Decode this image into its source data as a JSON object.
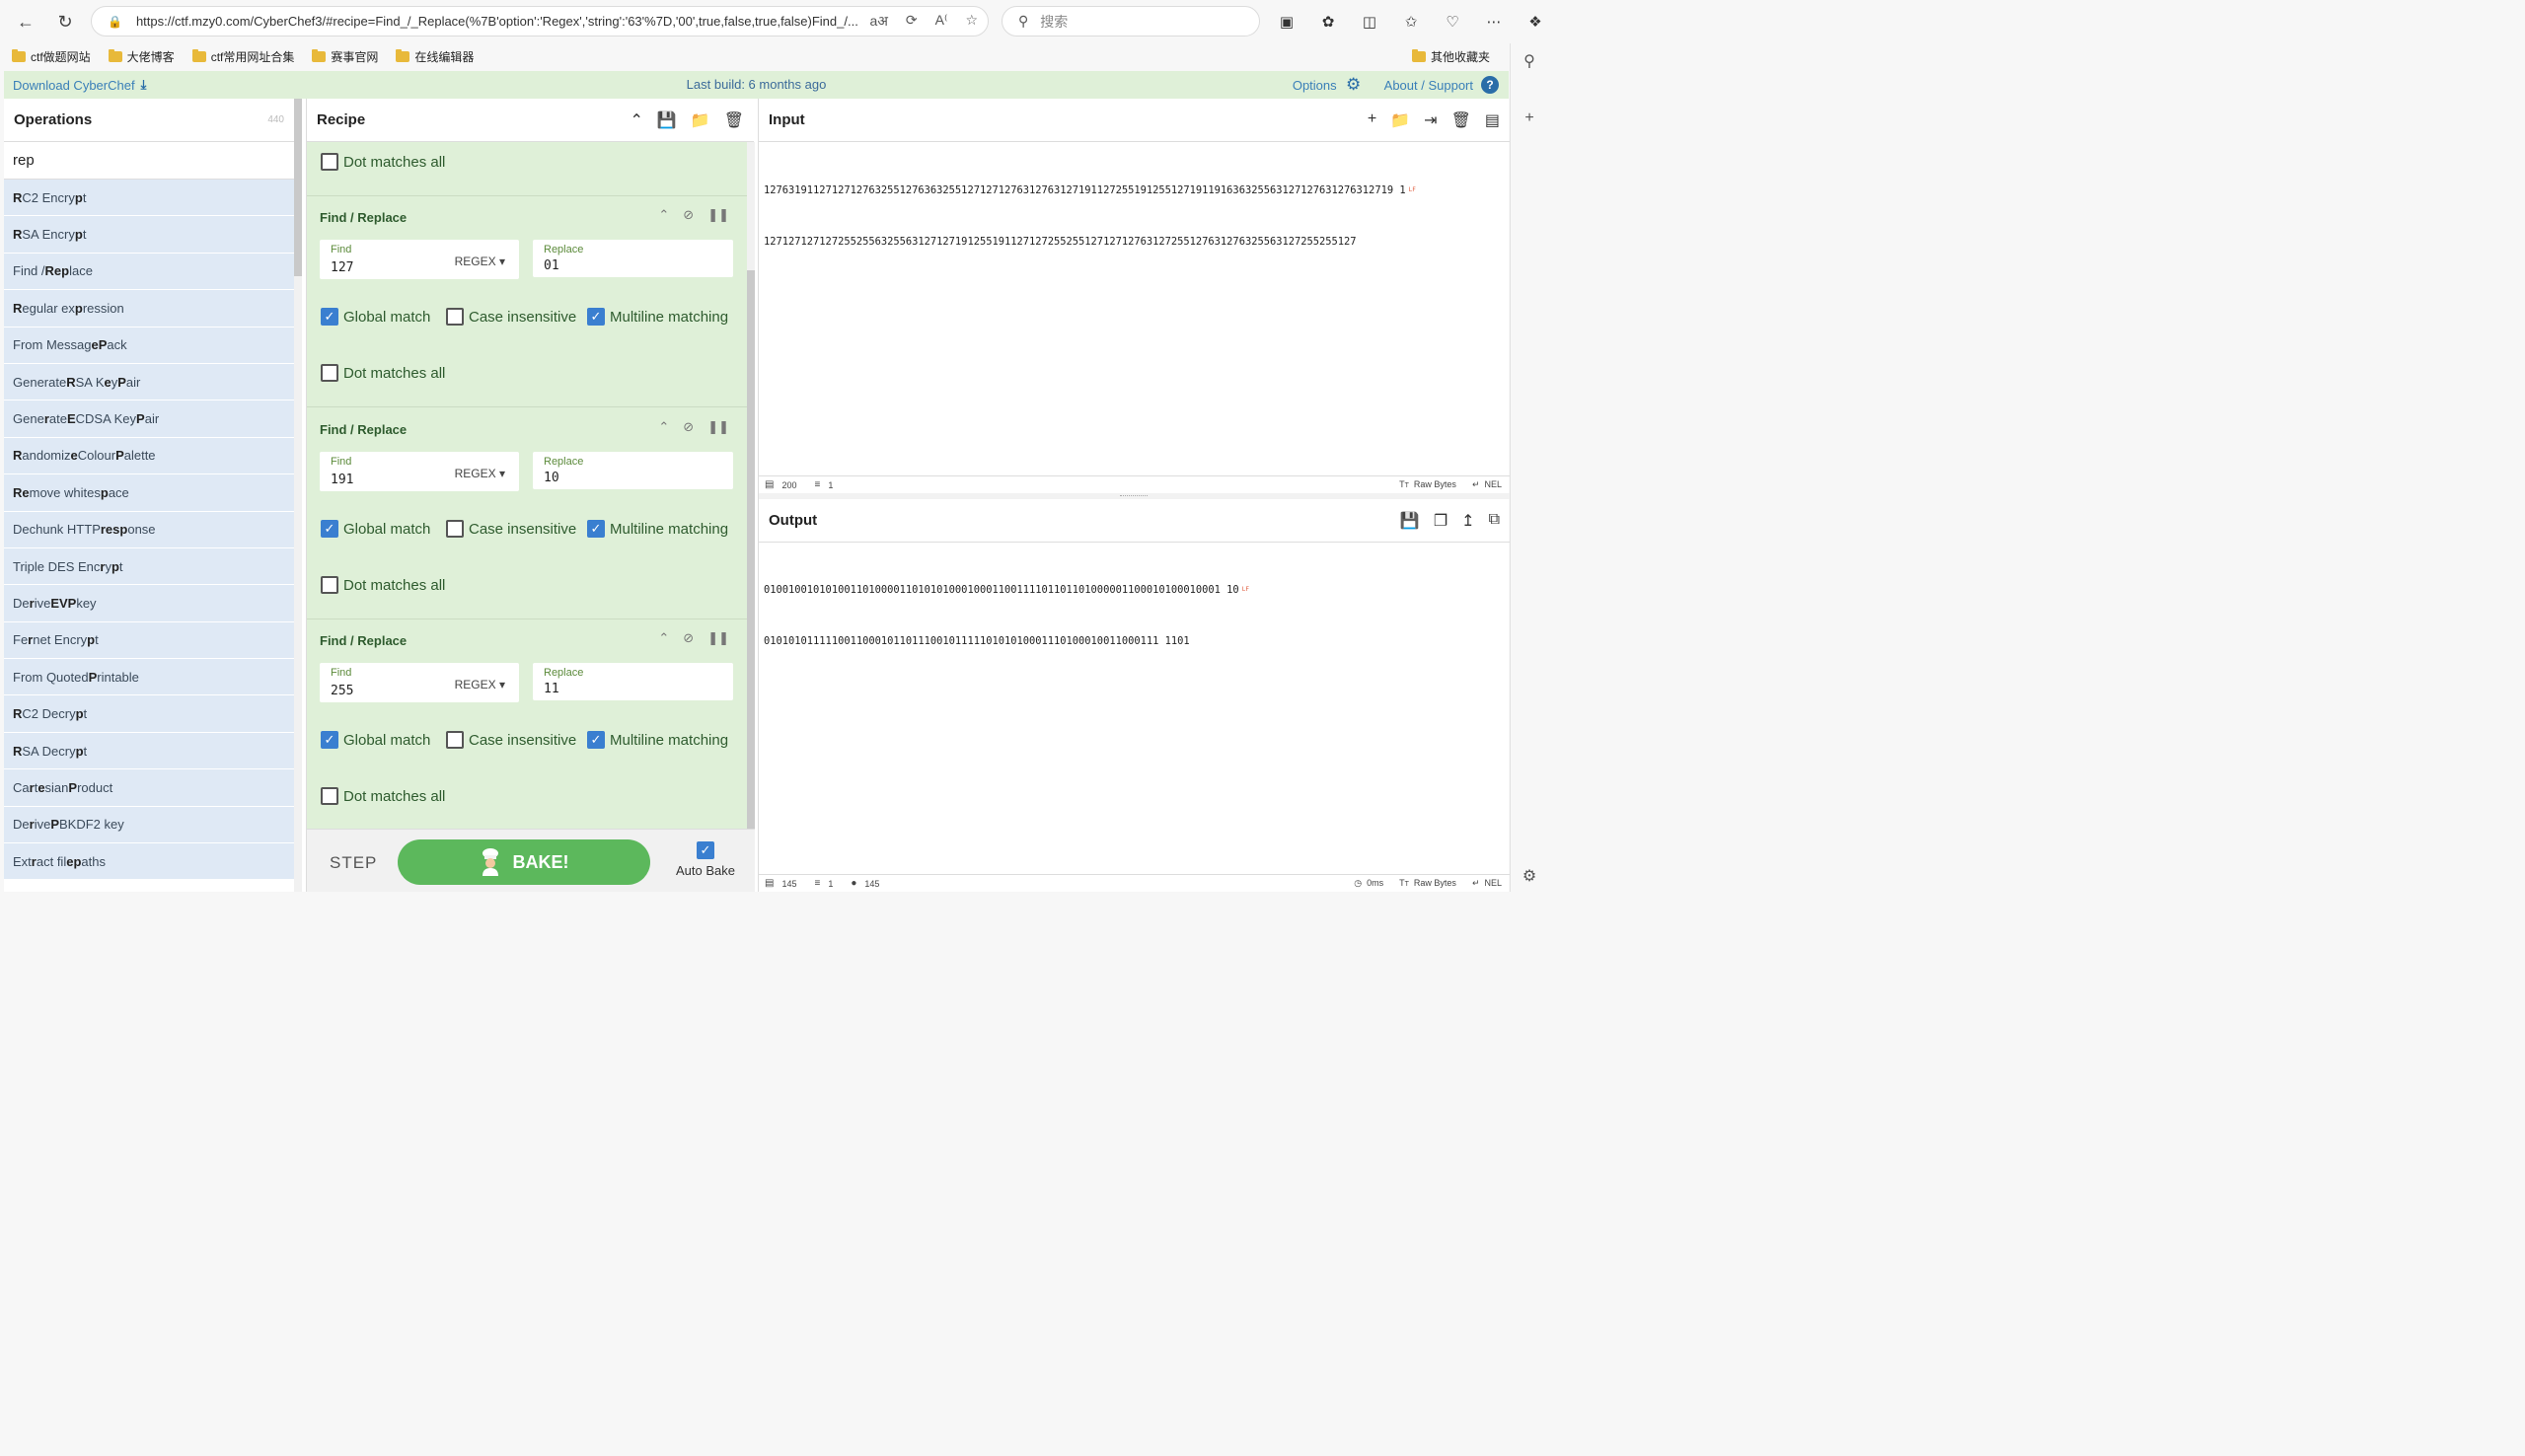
{
  "browser": {
    "url": "https://ctf.mzy0.com/CyberChef3/#recipe=Find_/_Replace(%7B'option':'Regex','string':'63'%7D,'00',true,false,true,false)Find_/...",
    "search_placeholder": "搜索",
    "bookmarks": [
      "ctf做题网站",
      "大佬博客",
      "ctf常用网址合集",
      "赛事官网",
      "在线编辑器"
    ],
    "other_bookmarks": "其他收藏夹"
  },
  "banner": {
    "download": "Download CyberChef",
    "build": "Last build: 6 months ago",
    "options": "Options",
    "about": "About / Support"
  },
  "operations": {
    "title": "Operations",
    "count": "440",
    "search_value": "rep",
    "items": [
      [
        {
          "t": "R",
          "b": true
        },
        {
          "t": "C2 Encry",
          "b": false
        },
        {
          "t": "p",
          "b": true
        },
        {
          "t": "t",
          "b": false
        }
      ],
      [
        {
          "t": "R",
          "b": true
        },
        {
          "t": "SA Encry",
          "b": false
        },
        {
          "t": "p",
          "b": true
        },
        {
          "t": "t",
          "b": false
        }
      ],
      [
        {
          "t": "Find / ",
          "b": false
        },
        {
          "t": "Rep",
          "b": true
        },
        {
          "t": "lace",
          "b": false
        }
      ],
      [
        {
          "t": "R",
          "b": true
        },
        {
          "t": "egular ex",
          "b": false
        },
        {
          "t": "p",
          "b": true
        },
        {
          "t": "ression",
          "b": false
        }
      ],
      [
        {
          "t": "From Messag",
          "b": false
        },
        {
          "t": "eP",
          "b": true
        },
        {
          "t": "ack",
          "b": false
        }
      ],
      [
        {
          "t": "Generate ",
          "b": false
        },
        {
          "t": "R",
          "b": true
        },
        {
          "t": "SA K",
          "b": false
        },
        {
          "t": "e",
          "b": true
        },
        {
          "t": "y ",
          "b": false
        },
        {
          "t": "P",
          "b": true
        },
        {
          "t": "air",
          "b": false
        }
      ],
      [
        {
          "t": "Gene",
          "b": false
        },
        {
          "t": "r",
          "b": true
        },
        {
          "t": "ate ",
          "b": false
        },
        {
          "t": "E",
          "b": true
        },
        {
          "t": "CDSA Key ",
          "b": false
        },
        {
          "t": "P",
          "b": true
        },
        {
          "t": "air",
          "b": false
        }
      ],
      [
        {
          "t": "R",
          "b": true
        },
        {
          "t": "andomiz",
          "b": false
        },
        {
          "t": "e",
          "b": true
        },
        {
          "t": " Colour ",
          "b": false
        },
        {
          "t": "P",
          "b": true
        },
        {
          "t": "alette",
          "b": false
        }
      ],
      [
        {
          "t": "Re",
          "b": true
        },
        {
          "t": "move whites",
          "b": false
        },
        {
          "t": "p",
          "b": true
        },
        {
          "t": "ace",
          "b": false
        }
      ],
      [
        {
          "t": "Dechunk HTTP ",
          "b": false
        },
        {
          "t": "resp",
          "b": true
        },
        {
          "t": "onse",
          "b": false
        }
      ],
      [
        {
          "t": "Triple DES Enc",
          "b": false
        },
        {
          "t": "r",
          "b": true
        },
        {
          "t": "y",
          "b": false
        },
        {
          "t": "p",
          "b": true
        },
        {
          "t": "t",
          "b": false
        }
      ],
      [
        {
          "t": "De",
          "b": false
        },
        {
          "t": "r",
          "b": true
        },
        {
          "t": "ive ",
          "b": false
        },
        {
          "t": "EVP",
          "b": true
        },
        {
          "t": " key",
          "b": false
        }
      ],
      [
        {
          "t": "Fe",
          "b": false
        },
        {
          "t": "r",
          "b": true
        },
        {
          "t": "net Encry",
          "b": false
        },
        {
          "t": "p",
          "b": true
        },
        {
          "t": "t",
          "b": false
        }
      ],
      [
        {
          "t": "From Quoted ",
          "b": false
        },
        {
          "t": "P",
          "b": true
        },
        {
          "t": "rintable",
          "b": false
        }
      ],
      [
        {
          "t": "R",
          "b": true
        },
        {
          "t": "C2 Decry",
          "b": false
        },
        {
          "t": "p",
          "b": true
        },
        {
          "t": "t",
          "b": false
        }
      ],
      [
        {
          "t": "R",
          "b": true
        },
        {
          "t": "SA Decry",
          "b": false
        },
        {
          "t": "p",
          "b": true
        },
        {
          "t": "t",
          "b": false
        }
      ],
      [
        {
          "t": "Ca",
          "b": false
        },
        {
          "t": "r",
          "b": true
        },
        {
          "t": "t",
          "b": false
        },
        {
          "t": "e",
          "b": true
        },
        {
          "t": "sian ",
          "b": false
        },
        {
          "t": "P",
          "b": true
        },
        {
          "t": "roduct",
          "b": false
        }
      ],
      [
        {
          "t": "De",
          "b": false
        },
        {
          "t": "r",
          "b": true
        },
        {
          "t": "ive ",
          "b": false
        },
        {
          "t": "P",
          "b": true
        },
        {
          "t": "BKDF2 key",
          "b": false
        }
      ],
      [
        {
          "t": "Ext",
          "b": false
        },
        {
          "t": "r",
          "b": true
        },
        {
          "t": "act fil",
          "b": false
        },
        {
          "t": "e",
          "b": true
        },
        {
          "t": " ",
          "b": false
        },
        {
          "t": "p",
          "b": true
        },
        {
          "t": "aths",
          "b": false
        }
      ]
    ]
  },
  "recipe": {
    "title": "Recipe",
    "top_dot_matches": "Dot matches all",
    "ops": [
      {
        "title": "Find / Replace",
        "find_label": "Find",
        "find": "127",
        "mode": "REGEX",
        "replace_label": "Replace",
        "replace": "01",
        "global": "Global match",
        "case": "Case insensitive",
        "multiline": "Multiline matching",
        "dot": "Dot matches all"
      },
      {
        "title": "Find / Replace",
        "find_label": "Find",
        "find": "191",
        "mode": "REGEX",
        "replace_label": "Replace",
        "replace": "10",
        "global": "Global match",
        "case": "Case insensitive",
        "multiline": "Multiline matching",
        "dot": "Dot matches all"
      },
      {
        "title": "Find / Replace",
        "find_label": "Find",
        "find": "255",
        "mode": "REGEX",
        "replace_label": "Replace",
        "replace": "11",
        "global": "Global match",
        "case": "Case insensitive",
        "multiline": "Multiline matching",
        "dot": "Dot matches all"
      }
    ],
    "step": "STEP",
    "bake": "BAKE!",
    "auto_bake": "Auto Bake"
  },
  "input": {
    "title": "Input",
    "line1": "127631911271271276325512763632551271271276312763127191127255191255127191191636325563127127631276312719 1",
    "line2": "1271271271272552556325563127127191255191127127255255127127127631272551276312763255631272552551​27",
    "status_chars": "200",
    "status_lines": "1",
    "raw_bytes": "Raw Bytes",
    "nel": "NEL"
  },
  "output": {
    "title": "Output",
    "line1": "01001001010100110100001101010100010001100111101101101000001100010100010001 10",
    "line2": "0101010111110011000101101110010111110101010001110100010011000111 1101",
    "status_chars": "145",
    "status_lines": "1",
    "status_pos": "145",
    "time": "0ms",
    "raw_bytes": "Raw Bytes",
    "nel": "NEL"
  }
}
